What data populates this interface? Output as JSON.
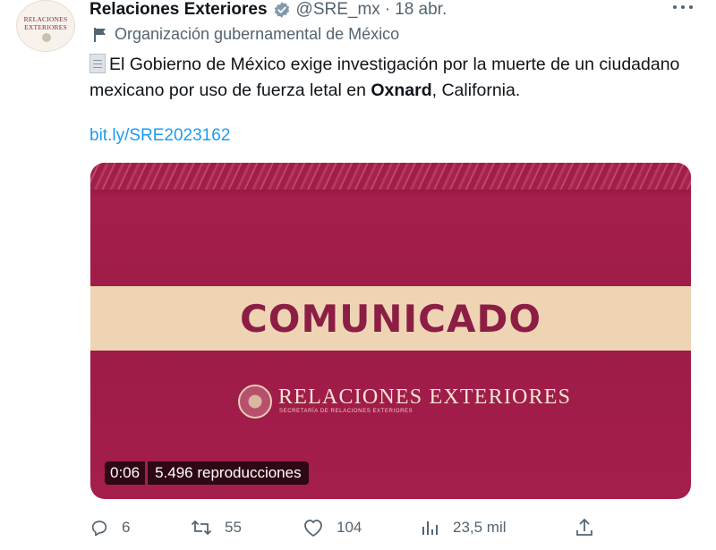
{
  "account": {
    "avatar_line1": "RELACIONES",
    "avatar_line2": "EXTERIORES",
    "name": "Relaciones Exteriores",
    "handle": "@SRE_mx",
    "separator": "·",
    "time": "18 abr.",
    "affiliation": "Organización gubernamental de México"
  },
  "tweet": {
    "text_before": "El Gobierno de México exige investigación por la muerte de un ciudadano mexicano por uso de fuerza letal en ",
    "text_bold": "Oxnard",
    "text_after": ", California.",
    "link": "bit.ly/SRE2023162"
  },
  "media": {
    "title": "COMUNICADO",
    "logo_text": "RELACIONES EXTERIORES",
    "logo_subtext": "SECRETARÍA DE RELACIONES EXTERIORES",
    "duration": "0:06",
    "views": "5.496 reproducciones",
    "colors": {
      "background": "#a71f4d",
      "band": "#efd4b4",
      "title": "#8c1e45"
    }
  },
  "actions": {
    "replies": "6",
    "retweets": "55",
    "likes": "104",
    "views": "23,5 mil"
  },
  "icons": [
    "verified-badge-icon",
    "more-icon",
    "flag-icon",
    "document-icon",
    "reply-icon",
    "retweet-icon",
    "like-icon",
    "views-icon",
    "share-icon"
  ],
  "colors": {
    "link": "#1d9bf0",
    "secondary_text": "#536471",
    "verified": "#829aab"
  }
}
